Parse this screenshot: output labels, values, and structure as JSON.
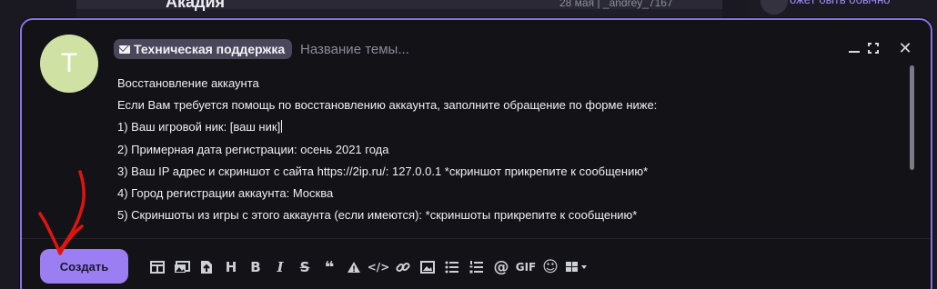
{
  "background": {
    "top_title": "Акадия",
    "top_meta": "28 мая | _andrey_7167",
    "side_link": "ожет быть обычно"
  },
  "editor": {
    "avatar_letter": "T",
    "category": "Техническая поддержка",
    "title_placeholder": "Название темы...",
    "body_lines": [
      "Восстановление аккаунта",
      "Если Вам требуется помощь по восстановлению аккаунта, заполните обращение по форме ниже:",
      "1) Ваш игровой ник: [ваш ник]",
      "2) Примерная дата регистрации: осень 2021 года",
      "3) Ваш IP адрес и скриншот с сайта https://2ip.ru/: 127.0.0.1 *скриншот прикрепите к сообщению*",
      "4) Город регистрации аккаунта: Москва",
      "5) Скриншоты из игры с этого аккаунта (если имеются): *скриншоты прикрепите к сообщению*"
    ],
    "submit_label": "Создать",
    "accent_color": "#9b7ff2",
    "arrow_color": "#e0140f"
  },
  "toolbar": {
    "heading": "H",
    "bold": "B",
    "italic": "I",
    "strike": "S",
    "quote": "❝",
    "alert": "!",
    "code": "</>",
    "mention": "@",
    "gif": "GIF",
    "emoji": "☺",
    "icons": [
      "toggle-view-icon",
      "gallery-icon",
      "upload-icon",
      "heading-icon",
      "bold-icon",
      "italic-icon",
      "strikethrough-icon",
      "quote-icon",
      "warning-icon",
      "code-icon",
      "link-icon",
      "image-icon",
      "bullet-list-icon",
      "numbered-list-icon",
      "mention-icon",
      "gif-icon",
      "emoji-icon",
      "more-icon"
    ]
  }
}
